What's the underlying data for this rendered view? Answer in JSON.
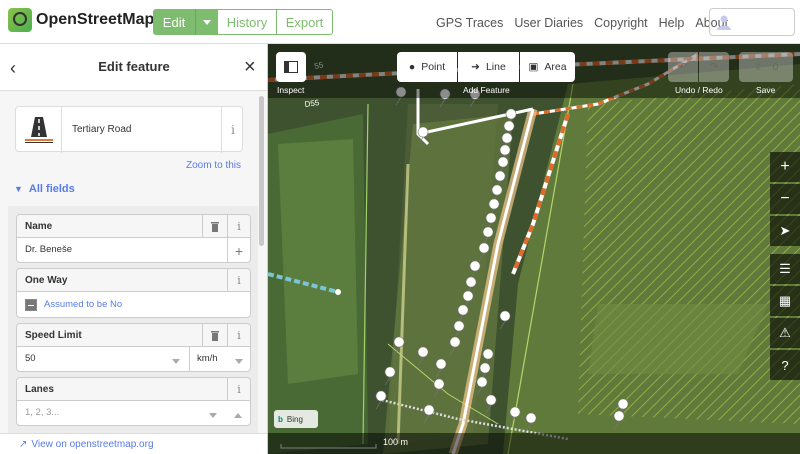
{
  "app": {
    "title": "OpenStreetMap"
  },
  "header": {
    "edit_label": "Edit",
    "history_label": "History",
    "export_label": "Export",
    "nav": [
      "GPS Traces",
      "User Diaries",
      "Copyright",
      "Help",
      "About"
    ]
  },
  "sidebar": {
    "title": "Edit feature",
    "preset_label": "Tertiary Road",
    "zoom_to_this": "Zoom to this",
    "all_fields": "All fields",
    "view_on_osm": "View on openstreetmap.org",
    "fields": {
      "name": {
        "label": "Name",
        "value": "Dr. Beneše"
      },
      "oneway": {
        "label": "One Way",
        "value": "Assumed to be No"
      },
      "speed": {
        "label": "Speed Limit",
        "value": "50",
        "unit": "km/h"
      },
      "lanes": {
        "label": "Lanes",
        "placeholder": "1, 2, 3..."
      }
    }
  },
  "map": {
    "inspect_label": "Inspect",
    "point_label": "Point",
    "line_label": "Line",
    "area_label": "Area",
    "add_feature_label": "Add Feature",
    "undo_redo_label": "Undo / Redo",
    "save_label": "Save",
    "save_count": "0",
    "road_ref_1": "55",
    "road_ref_2": "D55",
    "imagery": "Bing",
    "scale": "100 m"
  },
  "colors": {
    "accent": "#7ebc6f",
    "link": "#597be7"
  }
}
